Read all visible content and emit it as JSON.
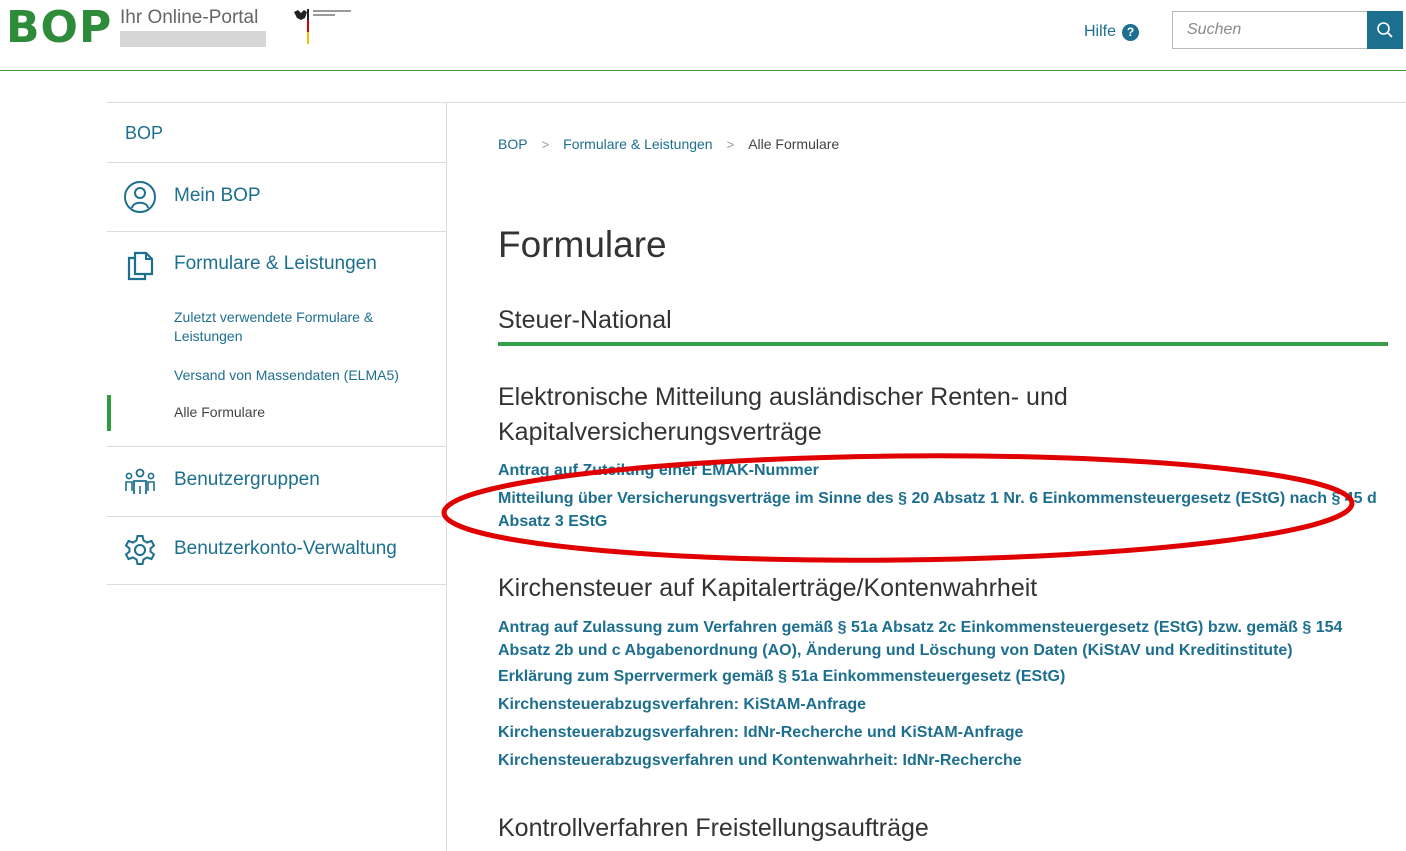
{
  "header": {
    "logo_text": "BOP",
    "tagline": "Ihr Online-Portal",
    "help_label": "Hilfe",
    "help_icon": "?",
    "search_placeholder": "Suchen",
    "search_icon": "search-icon"
  },
  "sidebar": {
    "root_label": "BOP",
    "items": [
      {
        "label": "Mein BOP",
        "icon": "user-circle-icon"
      },
      {
        "label": "Formulare & Leistungen",
        "icon": "documents-copy-icon"
      },
      {
        "label": "Benutzergruppen",
        "icon": "user-group-icon"
      },
      {
        "label": "Benutzerkonto-Verwaltung",
        "icon": "gear-icon"
      }
    ],
    "subitems": [
      {
        "label": "Zuletzt verwendete Formulare & Leistungen",
        "active": false
      },
      {
        "label": "Versand von Massendaten (ELMA5)",
        "active": false
      },
      {
        "label": "Alle Formulare",
        "active": true
      }
    ]
  },
  "breadcrumb": {
    "items": [
      "BOP",
      "Formulare & Leistungen"
    ],
    "current": "Alle Formulare",
    "separator": ">"
  },
  "main": {
    "title": "Formulare",
    "section_title": "Steuer-National",
    "groups": [
      {
        "title": "Elektronische Mitteilung ausländischer Renten- und Kapitalversicherungsverträge",
        "links": [
          "Antrag auf Zuteilung einer EMAK-Nummer",
          "Mitteilung über Versicherungsverträge im Sinne des § 20 Absatz 1 Nr. 6 Einkommensteuergesetz (EStG) nach § 45 d Absatz 3 EStG"
        ]
      },
      {
        "title": "Kirchensteuer auf Kapitalerträge/Kontenwahrheit",
        "links": [
          "Antrag auf Zulassung zum Verfahren gemäß § 51a Absatz 2c Einkommensteuergesetz (EStG) bzw. gemäß § 154 Absatz 2b und c Abgabenordnung (AO), Änderung und Löschung von Daten (KiStAV und Kreditinstitute)",
          "Erklärung zum Sperrvermerk gemäß § 51a Einkommensteuergesetz (EStG)",
          "Kirchensteuerabzugsverfahren: KiStAM-Anfrage",
          "Kirchensteuerabzugsverfahren: IdNr-Recherche und KiStAM-Anfrage",
          "Kirchensteuerabzugsverfahren und Kontenwahrheit: IdNr-Recherche"
        ]
      },
      {
        "title": "Kontrollverfahren Freistellungsaufträge",
        "links": []
      }
    ]
  },
  "colors": {
    "brand_green": "#2e8b3a",
    "link_blue": "#1d6f8f",
    "accent_line": "#34a04a",
    "annotation_red": "#e00000"
  }
}
